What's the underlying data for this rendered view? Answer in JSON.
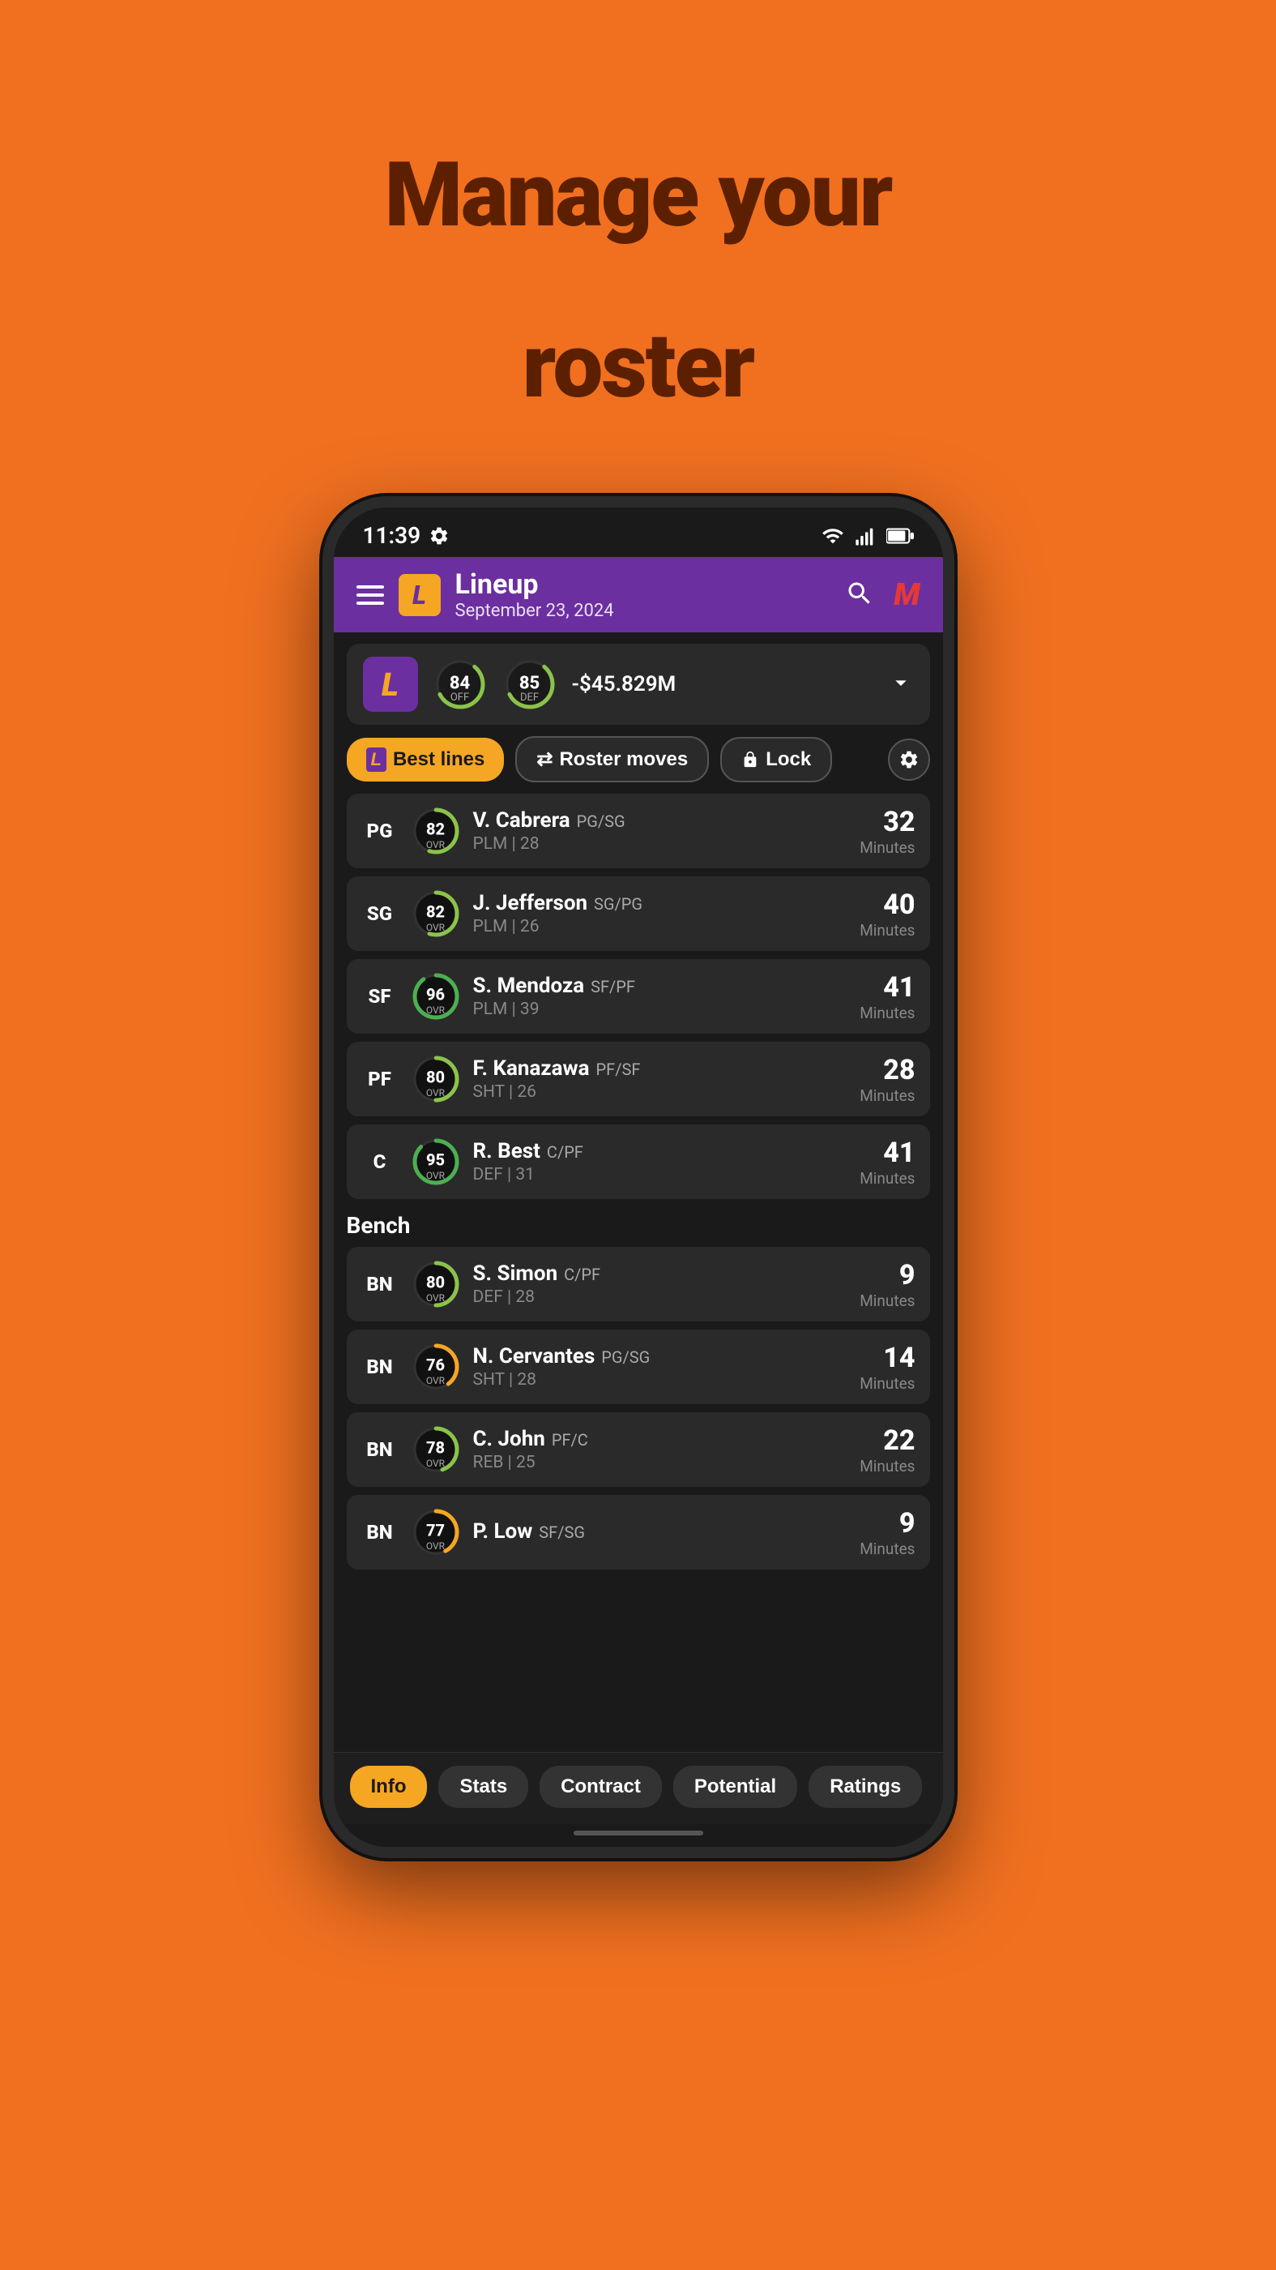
{
  "page": {
    "heading_line1": "Manage your",
    "heading_line2": "roster"
  },
  "status_bar": {
    "time": "11:39"
  },
  "header": {
    "title": "Lineup",
    "subtitle": "September 23, 2024",
    "team_logo": "L",
    "m_logo": "M"
  },
  "team_summary": {
    "logo": "L",
    "off_rating": "84",
    "off_label": "OFF",
    "def_rating": "85",
    "def_label": "DEF",
    "budget": "-$45.829M"
  },
  "actions": {
    "best_lines": "Best lines",
    "roster_moves": "Roster moves",
    "lock": "Lock"
  },
  "starters": [
    {
      "position": "PG",
      "ovr": "82",
      "name": "V. Cabrera",
      "pos_detail": "PG/SG",
      "team_detail": "PLM | 28",
      "minutes": "32",
      "ring_color": "#8BC34A"
    },
    {
      "position": "SG",
      "ovr": "82",
      "name": "J. Jefferson",
      "pos_detail": "SG/PG",
      "team_detail": "PLM | 26",
      "minutes": "40",
      "ring_color": "#8BC34A"
    },
    {
      "position": "SF",
      "ovr": "96",
      "name": "S. Mendoza",
      "pos_detail": "SF/PF",
      "team_detail": "PLM | 39",
      "minutes": "41",
      "ring_color": "#4CAF50"
    },
    {
      "position": "PF",
      "ovr": "80",
      "name": "F. Kanazawa",
      "pos_detail": "PF/SF",
      "team_detail": "SHT | 26",
      "minutes": "28",
      "ring_color": "#8BC34A"
    },
    {
      "position": "C",
      "ovr": "95",
      "name": "R. Best",
      "pos_detail": "C/PF",
      "team_detail": "DEF | 31",
      "minutes": "41",
      "ring_color": "#4CAF50"
    }
  ],
  "bench": [
    {
      "position": "BN",
      "ovr": "80",
      "name": "S. Simon",
      "pos_detail": "C/PF",
      "team_detail": "DEF | 28",
      "minutes": "9",
      "ring_color": "#8BC34A"
    },
    {
      "position": "BN",
      "ovr": "76",
      "name": "N. Cervantes",
      "pos_detail": "PG/SG",
      "team_detail": "SHT | 28",
      "minutes": "14",
      "ring_color": "#F5A623"
    },
    {
      "position": "BN",
      "ovr": "78",
      "name": "C. John",
      "pos_detail": "PF/C",
      "team_detail": "REB | 25",
      "minutes": "22",
      "ring_color": "#8BC34A"
    },
    {
      "position": "BN",
      "ovr": "77",
      "name": "P. Low",
      "pos_detail": "SF/SG",
      "team_detail": "",
      "minutes": "9",
      "ring_color": "#F5A623"
    }
  ],
  "bottom_tabs": [
    {
      "label": "Info",
      "active": true
    },
    {
      "label": "Stats",
      "active": false
    },
    {
      "label": "Contract",
      "active": false
    },
    {
      "label": "Potential",
      "active": false
    },
    {
      "label": "Ratings",
      "active": false
    }
  ]
}
